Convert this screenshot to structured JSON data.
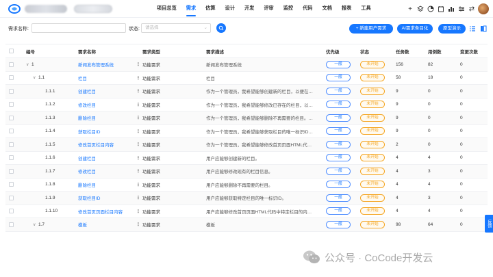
{
  "nav": {
    "items": [
      "项目总览",
      "需求",
      "估算",
      "设计",
      "开发",
      "评审",
      "监控",
      "代码",
      "文档",
      "报表",
      "工具"
    ],
    "active_index": 1
  },
  "filter": {
    "name_label": "需求名称:",
    "status_label": "状态:",
    "status_placeholder": "请选择",
    "new_button": "+ 新建用户需求",
    "ai_button": "AI需求条目化",
    "demo_button": "原型演示"
  },
  "table": {
    "headers": [
      "编号",
      "需求名称",
      "需求类型",
      "需求描述",
      "优先级",
      "状态",
      "任务数",
      "用例数",
      "变更次数"
    ],
    "rows": [
      {
        "num": "1",
        "expand": "∨",
        "name": "新闻发布管理系统",
        "type": "功能需求",
        "desc": "新闻发布管理系统",
        "pri": "一般",
        "stat": "未开始",
        "task": "156",
        "case": "82",
        "chg": "0"
      },
      {
        "num": "1.1",
        "expand": "∨",
        "name": "栏目",
        "type": "功能需求",
        "desc": "栏目",
        "pri": "一般",
        "stat": "未开始",
        "task": "58",
        "case": "18",
        "chg": "0"
      },
      {
        "num": "1.1.1",
        "expand": "",
        "name": "创建栏目",
        "type": "功能需求",
        "desc": "作为一个管理员，我希望能够创建新的栏目，以便在…",
        "pri": "一般",
        "stat": "未开始",
        "task": "9",
        "case": "0",
        "chg": "0"
      },
      {
        "num": "1.1.2",
        "expand": "",
        "name": "修改栏目",
        "type": "功能需求",
        "desc": "作为一个管理员，我希望能够修改已存在的栏目，以…",
        "pri": "一般",
        "stat": "未开始",
        "task": "9",
        "case": "0",
        "chg": "0"
      },
      {
        "num": "1.1.3",
        "expand": "",
        "name": "删除栏目",
        "type": "功能需求",
        "desc": "作为一个管理员，我希望能够删除不再需要的栏目。…",
        "pri": "一般",
        "stat": "未开始",
        "task": "9",
        "case": "0",
        "chg": "0"
      },
      {
        "num": "1.1.4",
        "expand": "",
        "name": "获取栏目ID",
        "type": "功能需求",
        "desc": "作为一个管理员，我希望能够获取栏目的唯一标识ID…",
        "pri": "一般",
        "stat": "未开始",
        "task": "9",
        "case": "0",
        "chg": "0"
      },
      {
        "num": "1.1.5",
        "expand": "",
        "name": "修改首页栏目内容",
        "type": "功能需求",
        "desc": "作为一个管理员，我希望能够修改首页页面HTML代…",
        "pri": "一般",
        "stat": "未开始",
        "task": "2",
        "case": "0",
        "chg": "0"
      },
      {
        "num": "1.1.6",
        "expand": "",
        "name": "创建栏目",
        "type": "功能需求",
        "desc": "用户应能够创建新的栏目。",
        "pri": "一般",
        "stat": "未开始",
        "task": "4",
        "case": "4",
        "chg": "0"
      },
      {
        "num": "1.1.7",
        "expand": "",
        "name": "修改栏目",
        "type": "功能需求",
        "desc": "用户应能够修改现有的栏目信息。",
        "pri": "一般",
        "stat": "未开始",
        "task": "4",
        "case": "3",
        "chg": "0"
      },
      {
        "num": "1.1.8",
        "expand": "",
        "name": "删除栏目",
        "type": "功能需求",
        "desc": "用户应能够删除不再需要的栏目。",
        "pri": "一般",
        "stat": "未开始",
        "task": "4",
        "case": "4",
        "chg": "0"
      },
      {
        "num": "1.1.9",
        "expand": "",
        "name": "获取栏目ID",
        "type": "功能需求",
        "desc": "用户应能够获取特定栏目的唯一标识ID。",
        "pri": "一般",
        "stat": "未开始",
        "task": "4",
        "case": "3",
        "chg": "0"
      },
      {
        "num": "1.1.10",
        "expand": "",
        "name": "修改首页页面栏目内容",
        "type": "功能需求",
        "desc": "用户应能够修改首页页面HTML代码中特定栏目的内…",
        "pri": "一般",
        "stat": "未开始",
        "task": "4",
        "case": "4",
        "chg": "0"
      },
      {
        "num": "1.7",
        "expand": "∨",
        "name": "模板",
        "type": "功能需求",
        "desc": "模板",
        "pri": "一般",
        "stat": "未开始",
        "task": "98",
        "case": "64",
        "chg": "0"
      }
    ]
  },
  "feedback_label": "反馈",
  "watermark": "公众号 · CoCode开发云",
  "colors": {
    "accent": "#1677ff",
    "status_orange": "#f5a623"
  }
}
